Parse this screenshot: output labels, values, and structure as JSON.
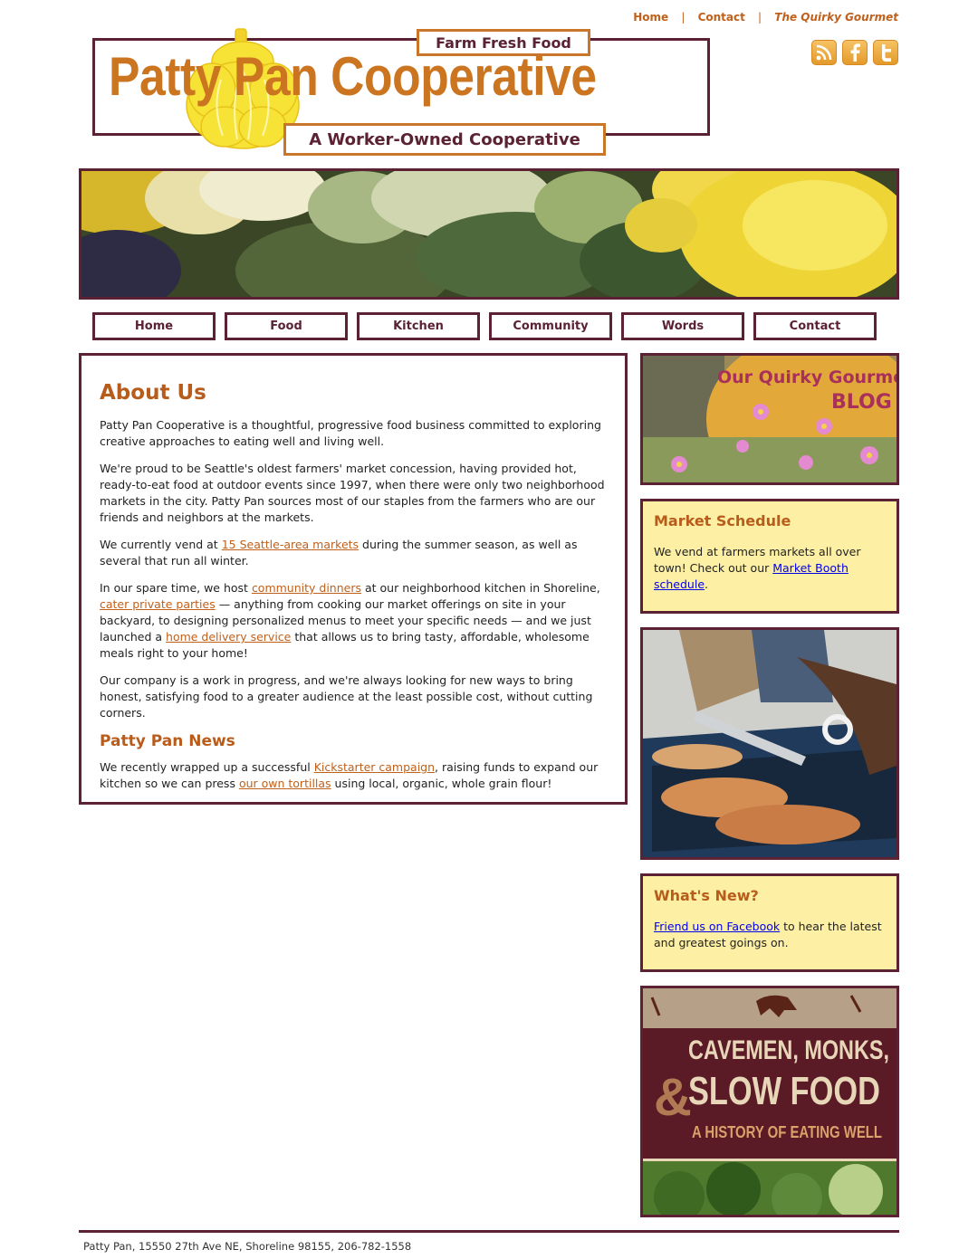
{
  "top_links": {
    "home": "Home",
    "contact": "Contact",
    "quirky": "The Quirky Gourmet",
    "sep": "|"
  },
  "social": {
    "rss": "rss-icon",
    "facebook": "facebook-icon",
    "twitter": "twitter-icon"
  },
  "logo": {
    "title": "Patty Pan Cooperative",
    "tag_top": "Farm Fresh Food",
    "tag_bottom": "A Worker-Owned Cooperative"
  },
  "nav": {
    "items": [
      "Home",
      "Food",
      "Kitchen",
      "Community",
      "Words",
      "Contact"
    ]
  },
  "main": {
    "heading": "About Us",
    "p1": "Patty Pan Cooperative is a thoughtful, progressive food business committed to exploring creative approaches to eating well and living well.",
    "p2": "We're proud to be Seattle's oldest farmers' market concession, having provided hot, ready-to-eat food at outdoor events since 1997, when there were only two neighborhood markets in the city. Patty Pan sources most of our staples from the farmers who are our friends and neighbors at the markets.",
    "p3_a": "We currently vend at ",
    "p3_link": "15 Seattle-area markets",
    "p3_b": " during the summer season, as well as several that run all winter.",
    "p4_a": "In our spare time, we host ",
    "p4_link1": "community dinners",
    "p4_b": " at our neighborhood kitchen in Shoreline, ",
    "p4_link2": "cater private parties",
    "p4_c": " — anything from cooking our market offerings on site in your backyard, to designing personalized menus to meet your specific needs — and we just launched a ",
    "p4_link3": "home delivery service",
    "p4_d": " that allows us to bring tasty, affordable, wholesome meals right to your home!",
    "p5": "Our company is a work in progress, and we're always looking for new ways to bring honest, satisfying food to a greater audience at the least possible cost, without cutting corners.",
    "news_heading": "Patty Pan News",
    "p6_a": "We recently wrapped up a successful ",
    "p6_link1": "Kickstarter campaign",
    "p6_b": ", raising funds to expand our kitchen so we can press ",
    "p6_link2": "our own tortillas",
    "p6_c": " using local, organic, whole grain flour!"
  },
  "sidebar": {
    "blog_line1": "Our Quirky Gourmet",
    "blog_line2": "BLOG",
    "schedule_heading": "Market Schedule",
    "schedule_a": "We vend at farmers markets all over town! Check out our ",
    "schedule_link": "Market Booth schedule",
    "schedule_b": ".",
    "news_heading": "What's New?",
    "news_link": "Friend us on Facebook",
    "news_b": " to hear the latest and greatest goings on.",
    "book_line1": "CAVEMEN, MONKS,",
    "book_amp": "&",
    "book_line2": "SLOW FOOD",
    "book_line3": "A HISTORY OF EATING WELL"
  },
  "footer": {
    "text": "Patty Pan, 15550 27th Ave NE, Shoreline 98155, 206-782-1558"
  },
  "colors": {
    "maroon": "#5b2233",
    "orange": "#c0601a",
    "cream": "#fdf0a4",
    "logo_orange": "#cb7521"
  }
}
